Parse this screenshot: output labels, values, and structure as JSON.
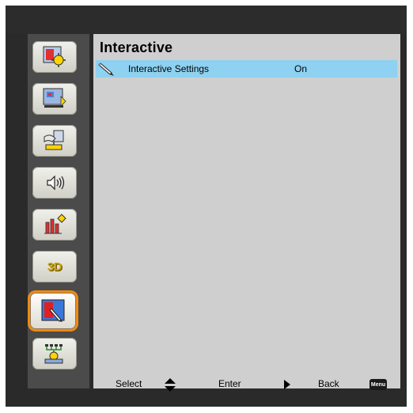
{
  "menu": {
    "title": "Interactive",
    "sidebar": [
      {
        "icon": "image-settings-icon",
        "active": false
      },
      {
        "icon": "screen-settings-icon",
        "active": false
      },
      {
        "icon": "setup-icon",
        "active": false
      },
      {
        "icon": "volume-icon",
        "active": false
      },
      {
        "icon": "options-icon",
        "active": false
      },
      {
        "icon": "3d-icon",
        "label": "3D",
        "active": false
      },
      {
        "icon": "interactive-icon",
        "active": true
      },
      {
        "icon": "network-icon",
        "active": false
      }
    ],
    "rows": [
      {
        "label": "Interactive Settings",
        "value": "On",
        "icon": "pen-icon",
        "selected": true
      }
    ]
  },
  "footer": {
    "select_label": "Select",
    "enter_label": "Enter",
    "back_label": "Back",
    "menu_key_label": "Menu"
  },
  "colors": {
    "highlight": "#8ed1f1",
    "active_border": "#f08a12",
    "content_bg": "#cfcfcf",
    "sidebar_bg": "#4b4b4b"
  }
}
